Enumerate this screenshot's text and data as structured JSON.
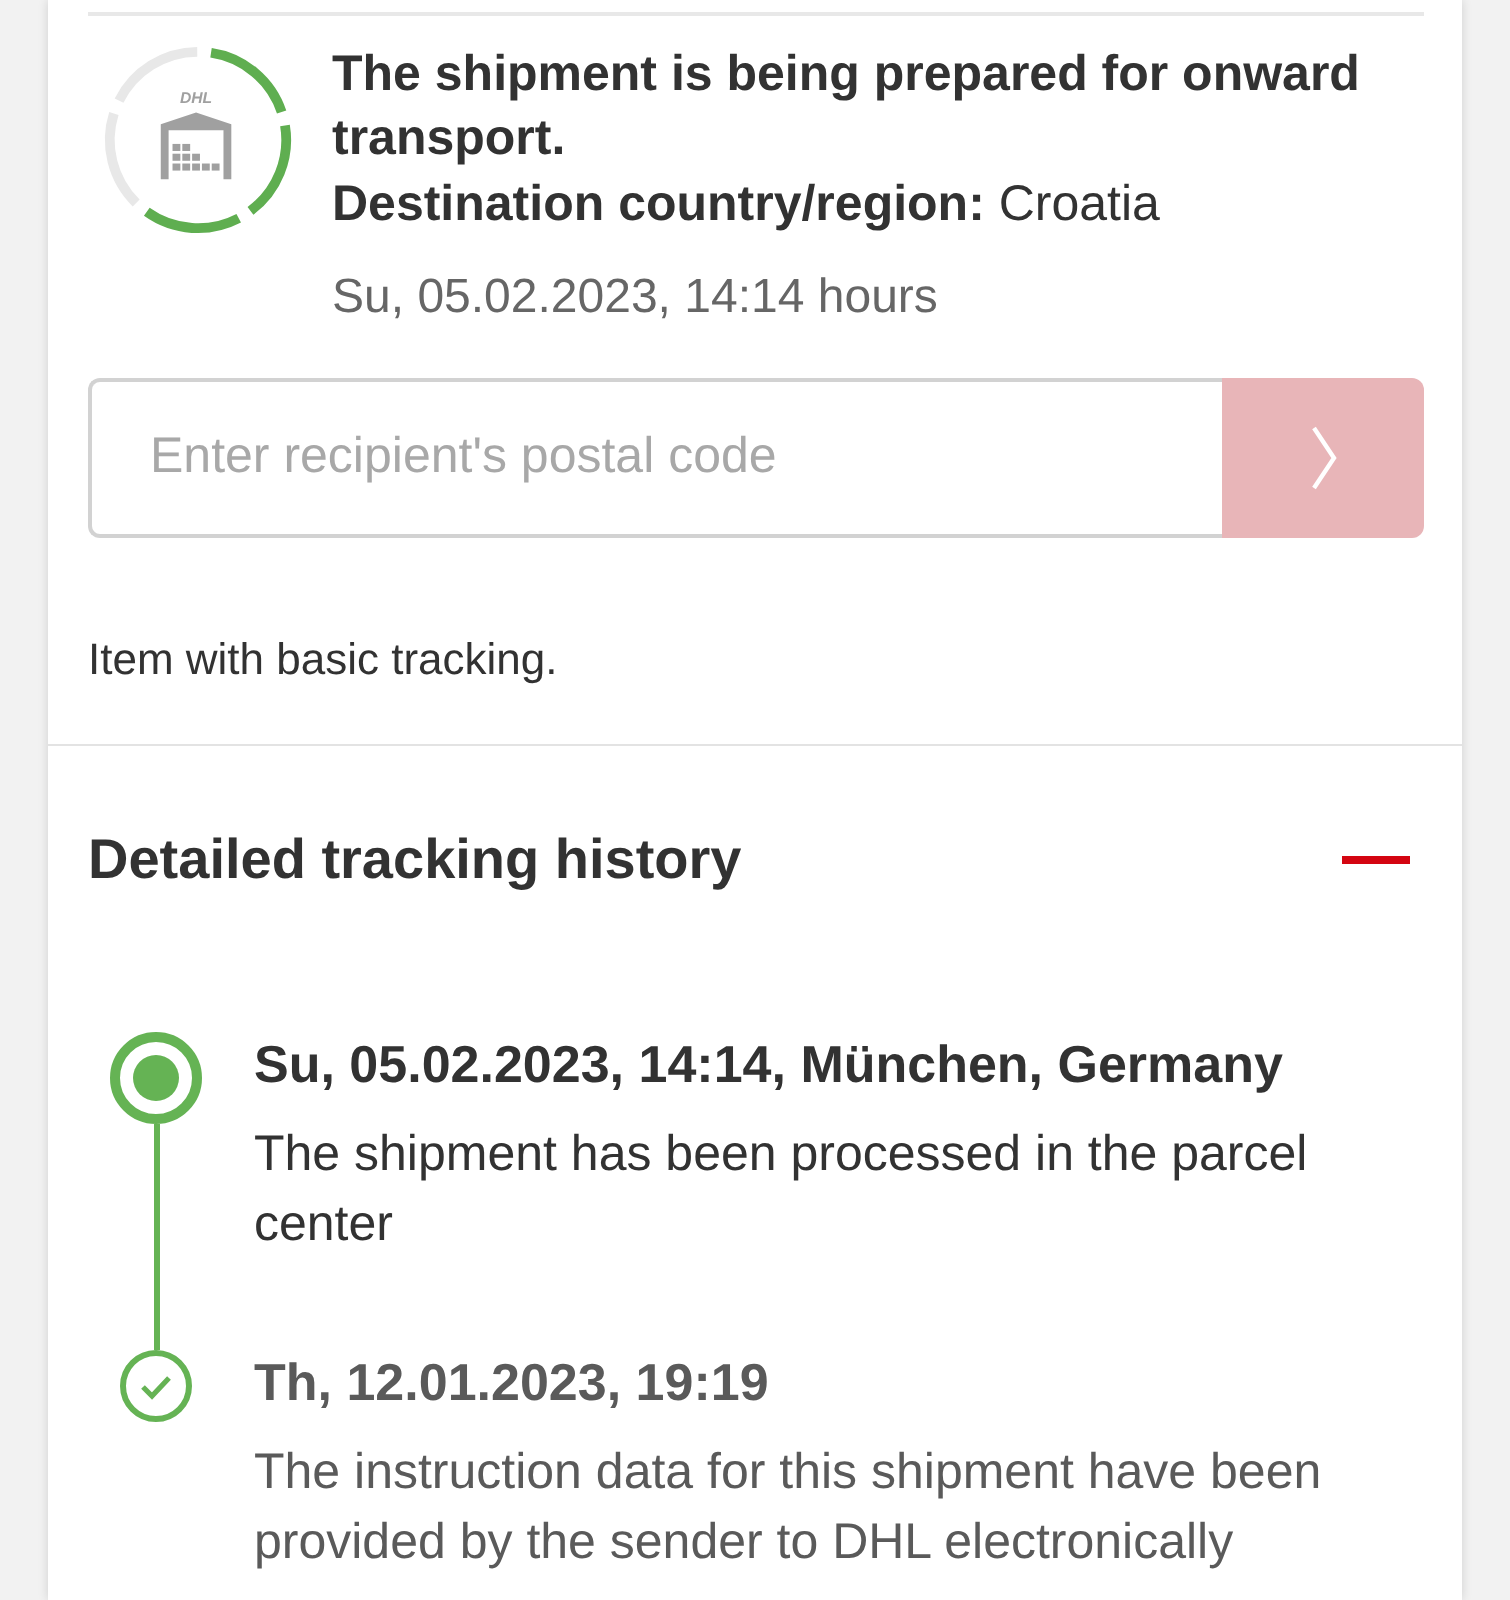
{
  "status": {
    "segments": [
      {
        "done": true
      },
      {
        "done": true
      },
      {
        "done": true
      },
      {
        "done": false
      },
      {
        "done": false
      }
    ],
    "logo": "DHL",
    "title": "The shipment is being prepared for onward transport.",
    "destination": "**Destination country/region:** Croatia",
    "timestamp": "Su, 05.02.2023, 14:14 hours"
  },
  "postal_code": {
    "placeholder": "Enter recipient's postal code",
    "submit_disabled": true
  },
  "note": "Item with basic tracking.",
  "history": {
    "title": "Detailed tracking history",
    "expanded": true,
    "events": [
      {
        "heading": "Su, 05.02.2023, 14:14, München, Germany",
        "description": "The shipment has been processed in the parcel center",
        "current": true
      },
      {
        "heading": "Th, 12.01.2023, 19:19",
        "description": "The instruction data for this shipment have been provided by the sender to DHL electronically",
        "current": false
      }
    ]
  }
}
